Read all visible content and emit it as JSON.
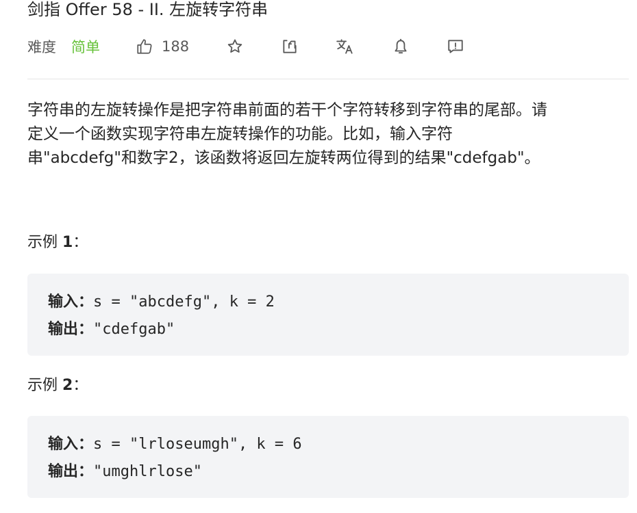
{
  "problem": {
    "title": "剑指 Offer 58 - II. 左旋转字符串",
    "difficulty_label": "难度",
    "difficulty_value": "简单",
    "like_count": "188"
  },
  "icons": {
    "like": "thumbs-up-icon",
    "favorite": "star-icon",
    "share": "share-icon",
    "translate": "translate-icon",
    "notify": "bell-icon",
    "feedback": "feedback-icon"
  },
  "description": {
    "lines": [
      "字符串的左旋转操作是把字符串前面的若干个字符转移到字符串的尾部。请",
      "定义一个函数实现字符串左旋转操作的功能。比如，输入字符",
      "串\"abcdefg\"和数字2，该函数将返回左旋转两位得到的结果\"cdefgab\"。"
    ]
  },
  "examples": [
    {
      "label_prefix": "示例 ",
      "label_num": "1",
      "label_suffix": "：",
      "input_key": "输入：",
      "input_value": "s = \"abcdefg\", k = 2",
      "output_key": "输出：",
      "output_value": "\"cdefgab\""
    },
    {
      "label_prefix": "示例 ",
      "label_num": "2",
      "label_suffix": "：",
      "input_key": "输入：",
      "input_value": "s = \"lrloseumgh\", k = 6",
      "output_key": "输出：",
      "output_value": "\"umghlrlose\""
    }
  ],
  "colors": {
    "difficulty_easy": "#67c23a",
    "code_bg": "#f3f4f6",
    "divider": "#e5e5e5",
    "text": "#262626",
    "muted": "#595959"
  }
}
